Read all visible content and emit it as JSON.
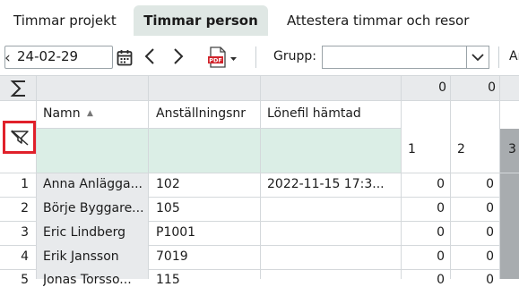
{
  "tabs": [
    {
      "label": "Timmar projekt",
      "active": false
    },
    {
      "label": "Timmar person",
      "active": true
    },
    {
      "label": "Attestera timmar och resor",
      "active": false
    }
  ],
  "toolbar": {
    "date_value": "24-02-29",
    "grupp_label": "Grupp:",
    "grupp_value": "",
    "truncated_label": "Ar",
    "pdf_text": "PDF"
  },
  "grid": {
    "sum_values": [
      "0",
      "0"
    ],
    "columns": {
      "name": "Namn",
      "emp": "Anställningsnr",
      "lonefil": "Lönefil hämtad",
      "day1": "1",
      "day2": "2",
      "day3": "3"
    },
    "rows": [
      {
        "num": "1",
        "name": "Anna Anlägga...",
        "emp": "102",
        "lonefil": "2022-11-15 17:3...",
        "d1": "0",
        "d2": "0"
      },
      {
        "num": "2",
        "name": "Börje Byggare...",
        "emp": "105",
        "lonefil": "",
        "d1": "0",
        "d2": "0"
      },
      {
        "num": "3",
        "name": "Eric Lindberg",
        "emp": "P1001",
        "lonefil": "",
        "d1": "0",
        "d2": "0"
      },
      {
        "num": "4",
        "name": "Erik Jansson",
        "emp": "7019",
        "lonefil": "",
        "d1": "0",
        "d2": "0"
      },
      {
        "num": "5",
        "name": "Jonas Torsso...",
        "emp": "115",
        "lonefil": "",
        "d1": "0",
        "d2": "0"
      }
    ]
  },
  "colors": {
    "active_tab_bg": "#dfe7e4",
    "filter_row_bg": "#dbeee6",
    "highlight_box": "#e0202a",
    "pdf_red": "#d1232a"
  }
}
